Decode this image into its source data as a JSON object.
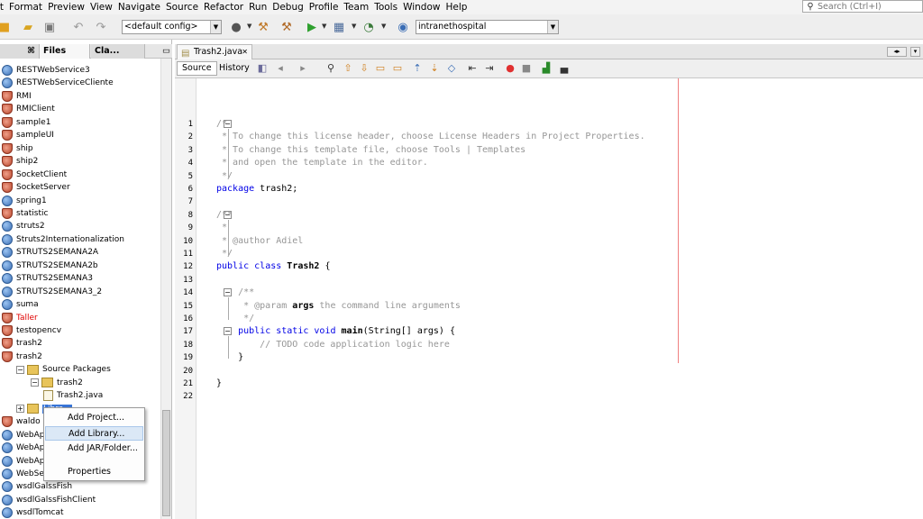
{
  "menubar": {
    "items": [
      "it",
      "Format",
      "Preview",
      "View",
      "Navigate",
      "Source",
      "Refactor",
      "Run",
      "Debug",
      "Profile",
      "Team",
      "Tools",
      "Window",
      "Help"
    ],
    "search_placeholder": "Search (Ctrl+I)"
  },
  "toolbar": {
    "config_combo": "<default config>",
    "project_combo": "intranethospital"
  },
  "left_panel": {
    "tabs": [
      "Files",
      "Cla..."
    ],
    "tree": [
      {
        "label": "RESTWebService3",
        "icon": "globe"
      },
      {
        "label": "RESTWebServiceCliente",
        "icon": "globe"
      },
      {
        "label": "RMI",
        "icon": "cup"
      },
      {
        "label": "RMIClient",
        "icon": "cup"
      },
      {
        "label": "sample1",
        "icon": "cup"
      },
      {
        "label": "sampleUI",
        "icon": "cup"
      },
      {
        "label": "ship",
        "icon": "cup"
      },
      {
        "label": "ship2",
        "icon": "cup"
      },
      {
        "label": "SocketClient",
        "icon": "cup"
      },
      {
        "label": "SocketServer",
        "icon": "cup"
      },
      {
        "label": "spring1",
        "icon": "globe"
      },
      {
        "label": "statistic",
        "icon": "cup"
      },
      {
        "label": "struts2",
        "icon": "globe"
      },
      {
        "label": "Struts2Internationalization",
        "icon": "globe"
      },
      {
        "label": "STRUTS2SEMANA2A",
        "icon": "globe"
      },
      {
        "label": "STRUTS2SEMANA2b",
        "icon": "globe"
      },
      {
        "label": "STRUTS2SEMANA3",
        "icon": "globe"
      },
      {
        "label": "STRUTS2SEMANA3_2",
        "icon": "globe"
      },
      {
        "label": "suma",
        "icon": "globe"
      },
      {
        "label": "Taller",
        "icon": "cup",
        "color": "#e00000"
      },
      {
        "label": "testopencv",
        "icon": "cup"
      },
      {
        "label": "trash2",
        "icon": "cup"
      },
      {
        "label": "trash2",
        "icon": "cup"
      },
      {
        "label": "Source Packages",
        "icon": "folder"
      },
      {
        "label": "trash2",
        "icon": "folder"
      },
      {
        "label": "Trash2.java",
        "icon": "javafile"
      },
      {
        "label": "Libra...",
        "icon": "folder"
      },
      {
        "label": "waldo",
        "icon": "cup"
      },
      {
        "label": "WebAp",
        "icon": "globe"
      },
      {
        "label": "WebAp",
        "icon": "globe"
      },
      {
        "label": "WebAp",
        "icon": "globe"
      },
      {
        "label": "WebSe",
        "icon": "globe"
      },
      {
        "label": "wsdlGalssFish",
        "icon": "globe"
      },
      {
        "label": "wsdlGalssFishClient",
        "icon": "globe"
      },
      {
        "label": "wsdlTomcat",
        "icon": "globe"
      }
    ]
  },
  "context_menu": {
    "items": [
      "Add Project...",
      "Add Library...",
      "Add JAR/Folder...",
      "Properties"
    ],
    "highlighted": "Add Library..."
  },
  "editor": {
    "tab_label": "Trash2.java",
    "source_button": "Source",
    "history_button": "History",
    "line_numbers": [
      "1",
      "2",
      "3",
      "4",
      "5",
      "6",
      "7",
      "8",
      "9",
      "10",
      "11",
      "12",
      "13",
      "14",
      "15",
      "16",
      "17",
      "18",
      "19",
      "20",
      "21",
      "22"
    ],
    "lines": [
      "/*",
      " * To change this license header, choose License Headers in Project Properties.",
      " * To change this template file, choose Tools | Templates",
      " * and open the template in the editor.",
      " */",
      "package trash2;",
      "",
      "/**",
      " *",
      " * @author Adiel",
      " */",
      "public class Trash2 {",
      "",
      "    /**",
      "     * @param args the command line arguments",
      "     */",
      "    public static void main(String[] args) {",
      "        // TODO code application logic here",
      "    }",
      "",
      "}",
      ""
    ]
  },
  "colors": {
    "comment": "#969696",
    "keyword": "#0000e6",
    "margin_line": "#f08080",
    "selection_highlight": "#dbe8f6"
  }
}
